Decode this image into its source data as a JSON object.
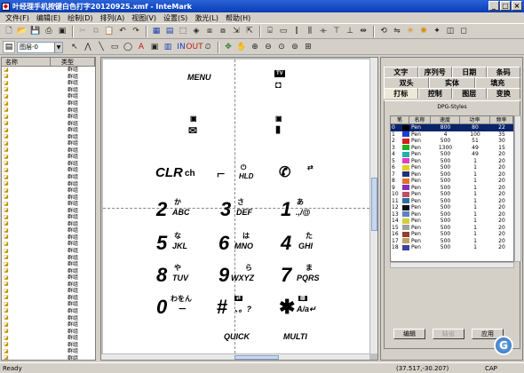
{
  "window": {
    "title": "叶经理手机按键白色打字20120925.xmf - InteMark"
  },
  "menu": [
    "文件(F)",
    "编辑(E)",
    "绘制(D)",
    "排列(A)",
    "视图(V)",
    "设置(S)",
    "激光(L)",
    "帮助(H)"
  ],
  "toolbar": {
    "layer_select": "图层-0"
  },
  "object_list": {
    "col_name": "名称",
    "col_type": "类型",
    "rows": [
      "群组",
      "群组",
      "群组",
      "群组",
      "群组",
      "群组",
      "群组",
      "群组",
      "群组",
      "群组",
      "群组",
      "群组",
      "群组",
      "群组",
      "群组",
      "群组",
      "群组",
      "群组",
      "群组",
      "群组",
      "群组",
      "群组",
      "群组",
      "群组",
      "群组",
      "群组",
      "群组",
      "群组",
      "群组",
      "群组",
      "群组",
      "群组",
      "群组",
      "群组",
      "群组",
      "群组",
      "群组",
      "群组",
      "群组",
      "群组",
      "群组",
      "群组",
      "群组",
      "群组"
    ]
  },
  "canvas": {
    "menu_label": "MENU",
    "tv_badge": "TV",
    "quick": "QUICK",
    "multi": "MULTI",
    "clr": "CLR",
    "ch": "ch",
    "hld": "HLD",
    "keys": [
      {
        "digit": "2",
        "kana": "か",
        "letters": "ABC"
      },
      {
        "digit": "3",
        "kana": "さ",
        "letters": "DEF"
      },
      {
        "digit": "1",
        "kana": "あ",
        "letters": ".,/@"
      },
      {
        "digit": "5",
        "kana": "な",
        "letters": "JKL"
      },
      {
        "digit": "6",
        "kana": "は",
        "letters": "MNO"
      },
      {
        "digit": "4",
        "kana": "た",
        "letters": "GHI"
      },
      {
        "digit": "8",
        "kana": "や",
        "letters": "TUV"
      },
      {
        "digit": "9",
        "kana": "ら",
        "letters": "WXYZ"
      },
      {
        "digit": "7",
        "kana": "ま",
        "letters": "PQRS"
      },
      {
        "digit": "0",
        "kana": "わをん",
        "letters": "ー"
      },
      {
        "digit": "#",
        "kana": "",
        "letters": "、。?"
      },
      {
        "digit": "✱",
        "kana": "",
        "letters": "A/a↵"
      }
    ]
  },
  "right_panel": {
    "tabs_row1": [
      "文字",
      "序列号",
      "日期",
      "条码"
    ],
    "tabs_row2": [
      "双头",
      "实体",
      "填充"
    ],
    "tabs_row3": [
      "打标",
      "控制",
      "图层",
      "变换"
    ],
    "active_tab": "打标",
    "pen_title": "DPG-Styles",
    "pen_headers": [
      "笔",
      "名称",
      "速度",
      "功率",
      "频率"
    ],
    "pens": [
      {
        "n": "0",
        "name": "Pen",
        "speed": "800",
        "power": "80",
        "freq": "22",
        "color": "#000000",
        "selected": true
      },
      {
        "n": "1",
        "name": "Pen",
        "speed": "4",
        "power": "100",
        "freq": "35",
        "color": "#1f3fd0"
      },
      {
        "n": "2",
        "name": "Pen",
        "speed": "500",
        "power": "51",
        "freq": "30",
        "color": "#d02020"
      },
      {
        "n": "3",
        "name": "Pen",
        "speed": "1300",
        "power": "49",
        "freq": "15",
        "color": "#20b020"
      },
      {
        "n": "4",
        "name": "Pen",
        "speed": "500",
        "power": "49",
        "freq": "20",
        "color": "#20b0b0"
      },
      {
        "n": "5",
        "name": "Pen",
        "speed": "500",
        "power": "1",
        "freq": "20",
        "color": "#e040c0"
      },
      {
        "n": "6",
        "name": "Pen",
        "speed": "500",
        "power": "1",
        "freq": "20",
        "color": "#e0d020"
      },
      {
        "n": "7",
        "name": "Pen",
        "speed": "500",
        "power": "1",
        "freq": "20",
        "color": "#203080"
      },
      {
        "n": "8",
        "name": "Pen",
        "speed": "500",
        "power": "1",
        "freq": "20",
        "color": "#e07030"
      },
      {
        "n": "9",
        "name": "Pen",
        "speed": "500",
        "power": "1",
        "freq": "20",
        "color": "#8030c0"
      },
      {
        "n": "10",
        "name": "Pen",
        "speed": "500",
        "power": "1",
        "freq": "20",
        "color": "#c05060"
      },
      {
        "n": "11",
        "name": "Pen",
        "speed": "500",
        "power": "1",
        "freq": "20",
        "color": "#3070a0"
      },
      {
        "n": "12",
        "name": "Pen",
        "speed": "500",
        "power": "1",
        "freq": "20",
        "color": "#101010"
      },
      {
        "n": "13",
        "name": "Pen",
        "speed": "500",
        "power": "1",
        "freq": "20",
        "color": "#6080c0"
      },
      {
        "n": "14",
        "name": "Pen",
        "speed": "500",
        "power": "1",
        "freq": "20",
        "color": "#d0d040"
      },
      {
        "n": "15",
        "name": "Pen",
        "speed": "500",
        "power": "1",
        "freq": "20",
        "color": "#a0a0a0"
      },
      {
        "n": "16",
        "name": "Pen",
        "speed": "500",
        "power": "1",
        "freq": "20",
        "color": "#904030"
      },
      {
        "n": "17",
        "name": "Pen",
        "speed": "500",
        "power": "1",
        "freq": "20",
        "color": "#c0a060"
      },
      {
        "n": "18",
        "name": "Pen",
        "speed": "500",
        "power": "1",
        "freq": "20",
        "color": "#4040a0"
      }
    ],
    "buttons": {
      "edit": "编辑",
      "default": "缺省",
      "apply": "应用"
    }
  },
  "status": {
    "left": "Ready",
    "coords": "(37.517,-30.207)",
    "caps": "CAP"
  },
  "badge": "G"
}
